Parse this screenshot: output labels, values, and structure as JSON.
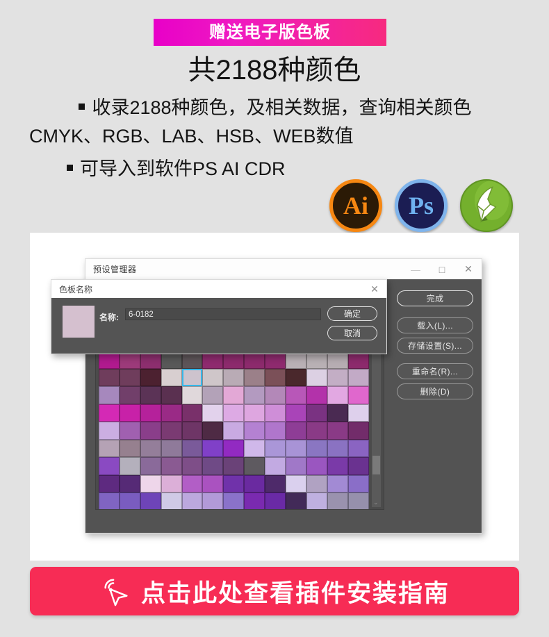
{
  "promo": {
    "badge_text": "赠送电子版色板",
    "badge_gradient_from": "#e800c8",
    "badge_gradient_to": "#f72a7f",
    "headline": "共2188种颜色",
    "bullet_1_line_1": "收录2188种颜色，及相关数据，查询相关颜色",
    "bullet_1_line_2": "CMYK、RGB、LAB、HSB、WEB数值",
    "bullet_2": "可导入到软件PS AI CDR"
  },
  "apps": [
    {
      "id": "illustrator",
      "label": "Ai",
      "ring": "#f68712",
      "fill": "#2b1a06"
    },
    {
      "id": "photoshop",
      "label": "Ps",
      "ring": "#7fb4ec",
      "fill": "#1b1d53"
    },
    {
      "id": "coreldraw",
      "label": "",
      "ring": "#5f9423",
      "fill": "#74b02d"
    }
  ],
  "preset_manager": {
    "title": "预设管理器",
    "window_buttons": {
      "minimize": "—",
      "maximize": "□",
      "close": "✕"
    },
    "side_buttons": [
      {
        "label": "完成",
        "primary": true
      },
      {
        "label": "载入(L)...",
        "primary": false
      },
      {
        "label": "存储设置(S)...",
        "primary": false
      },
      {
        "label": "重命名(R)...",
        "primary": false
      },
      {
        "label": "删除(D)",
        "primary": false
      }
    ],
    "scrollbar_arrow": "⌄"
  },
  "swatch_name_dialog": {
    "title": "色板名称",
    "close": "✕",
    "field_label": "名称:",
    "field_value": "6-0182",
    "preview_color": "#d5c0cf",
    "buttons": [
      {
        "label": "确定"
      },
      {
        "label": "取消"
      }
    ]
  },
  "cta": {
    "text": "点击此处查看插件安装指南",
    "background": "#f72c55",
    "icon": "click-cursor-icon"
  },
  "swatch_grid": {
    "columns": 13,
    "selected_index": 17,
    "colors": [
      "#b01a8e",
      "#9c3a7a",
      "#8c2e6e",
      "#585858",
      "#5d5458",
      "#8e2a6e",
      "#8c2a6c",
      "#8c2a6c",
      "#8e2a6e",
      "#b9b0b5",
      "#b8b0b4",
      "#b6adb2",
      "#8c2a6c",
      "#6f3d5c",
      "#6f3d5c",
      "#4c2130",
      "#d8cfd0",
      "#cdc3cd",
      "#cfc6c9",
      "#b9abb5",
      "#9b8089",
      "#7b5058",
      "#4a282c",
      "#dcd0e3",
      "#c3aec5",
      "#c2aac6",
      "#a688bd",
      "#713f6a",
      "#5b3356",
      "#5a3050",
      "#e0d8db",
      "#b3a2b8",
      "#e3a8d6",
      "#b39ac0",
      "#b388b8",
      "#b857b8",
      "#b332aa",
      "#e2a8e2",
      "#e067cd",
      "#d429b5",
      "#c821a8",
      "#b5219b",
      "#9a2a86",
      "#79306a",
      "#e2d2ec",
      "#ddaae4",
      "#dea6e0",
      "#cf8ed8",
      "#a944b8",
      "#7a3282",
      "#4a2a52",
      "#ded0ec",
      "#cbaee2",
      "#a060b0",
      "#8a3e8a",
      "#7a3a72",
      "#6e3566",
      "#4e2a44",
      "#c9aae2",
      "#b481d2",
      "#b076cc",
      "#8e3d96",
      "#8a3a86",
      "#8a3a86",
      "#722c6a",
      "#b5a2b5",
      "#96808f",
      "#947e9a",
      "#8f7a9a",
      "#7a5a9a",
      "#8040c8",
      "#922ac2",
      "#d0b8ea",
      "#aa96d8",
      "#a893d6",
      "#8a76c2",
      "#8a72c2",
      "#8a64c2",
      "#8a4ac2",
      "#b4b0bc",
      "#8a6a9a",
      "#8a5a92",
      "#7e4e88",
      "#6f4a86",
      "#6a4278",
      "#5e5a60",
      "#c2aae2",
      "#a078c8",
      "#9a56c0",
      "#7a3aa8",
      "#6a3290",
      "#5e2a80",
      "#562a76",
      "#eed6ea",
      "#dcafd8",
      "#b25ec6",
      "#aa52c0",
      "#7032aa",
      "#6a2aa0",
      "#4e2a6a",
      "#dad0ee",
      "#b0a2c2",
      "#a28ad4",
      "#8a6ec8",
      "#8064c2",
      "#7a5cc0",
      "#6e44b8",
      "#d0cae6",
      "#bca8de",
      "#b29ad8",
      "#8a72ca",
      "#7a2ab0",
      "#6a2aa6",
      "#422a58",
      "#bfb0e0",
      "#9a92ae",
      "#9690ac",
      "#6e66b2",
      "#7060b4",
      "#6656c0",
      "#5c46c0",
      "#c2b2c6",
      "#8a7ac0",
      "#7266c0",
      "#6a5ec0"
    ]
  }
}
